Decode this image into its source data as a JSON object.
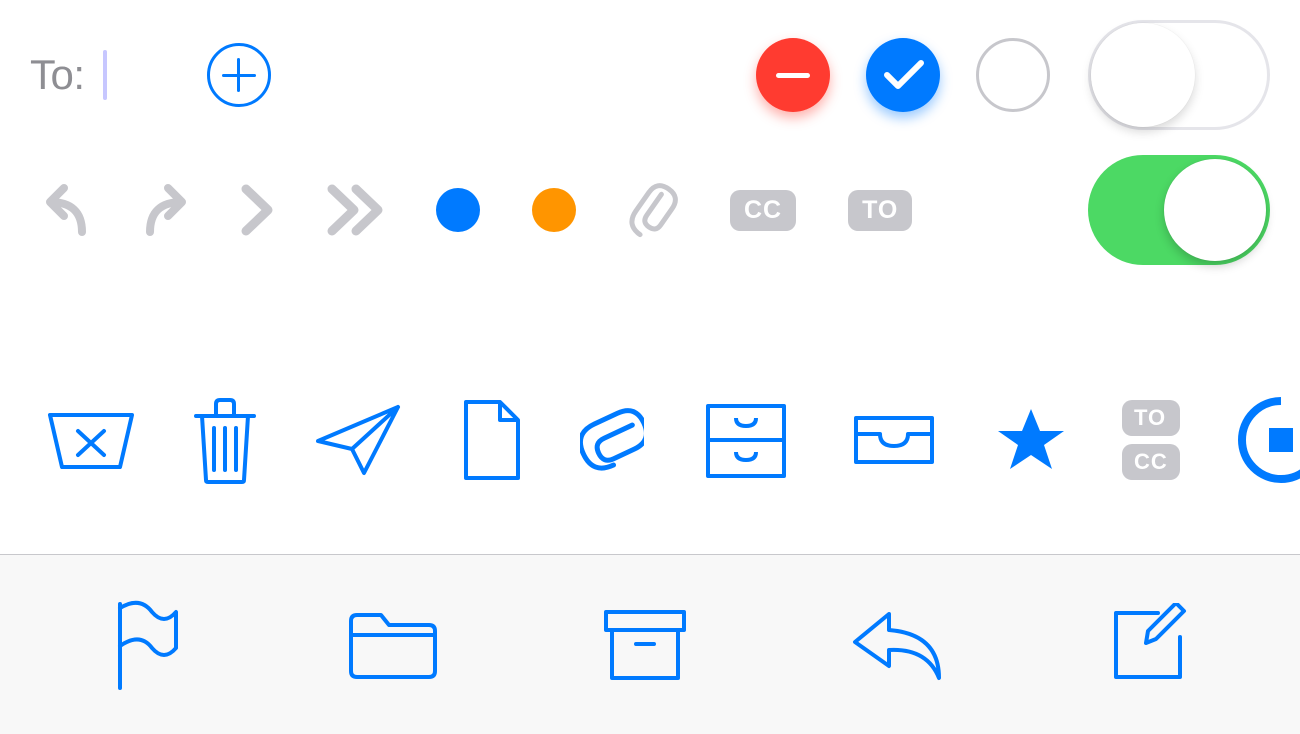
{
  "row1": {
    "to_label": "To:",
    "colors": {
      "red": "#ff3b30",
      "blue": "#007aff"
    }
  },
  "row2": {
    "badge_cc": "CC",
    "badge_to": "TO",
    "dot_colors": {
      "blue": "#007aff",
      "orange": "#ff9500"
    }
  },
  "row3": {
    "badge_to": "TO",
    "badge_cc": "CC"
  },
  "toolbar": {
    "items": [
      "flag",
      "folder",
      "archive",
      "reply",
      "compose"
    ]
  }
}
